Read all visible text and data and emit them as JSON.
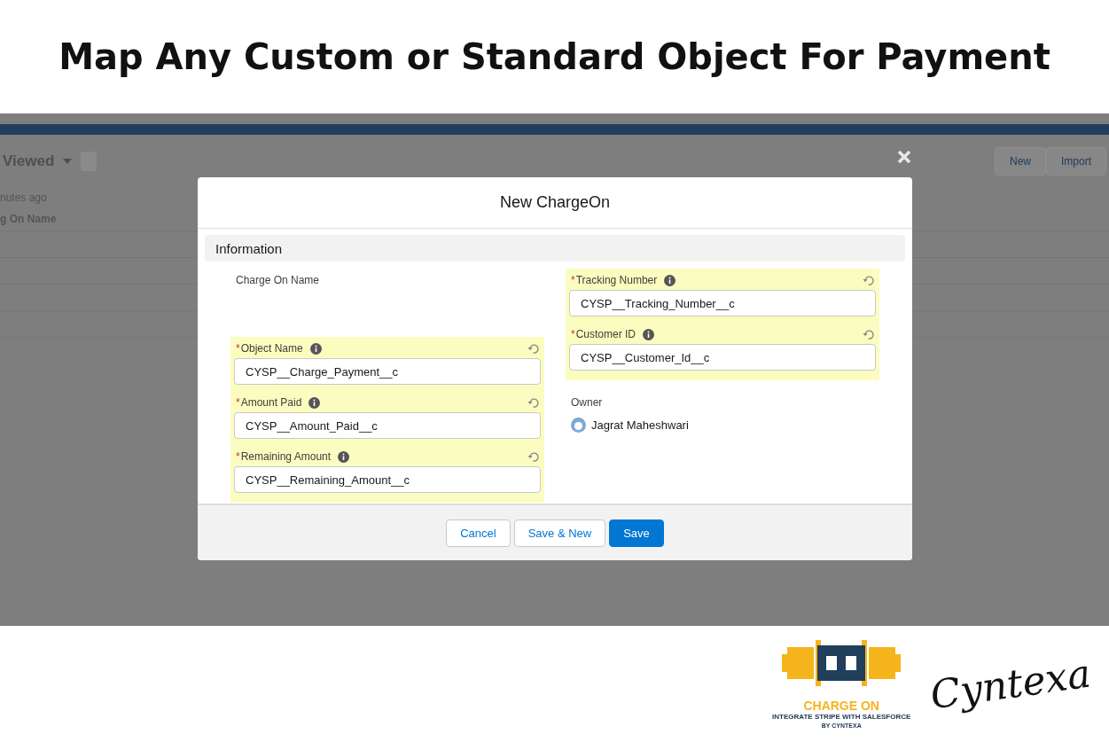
{
  "heading": "Map Any Custom or Standard Object For Payment",
  "background_app": {
    "list_title": "Viewed",
    "subtitle": "nutes ago",
    "column_header": "g On Name",
    "buttons": [
      "New",
      "Import"
    ]
  },
  "modal": {
    "title": "New ChargeOn",
    "section": "Information",
    "columns": [
      [
        {
          "highlighted": false,
          "fields": [
            {
              "kind": "blank",
              "label": "Charge On Name"
            }
          ]
        },
        {
          "highlighted": true,
          "fields": [
            {
              "kind": "input",
              "required_mark": "*",
              "label": "Object Name",
              "value": "CYSP__Charge_Payment__c"
            },
            {
              "kind": "input",
              "required_mark": "*",
              "label": "Amount Paid",
              "value": "CYSP__Amount_Paid__c"
            },
            {
              "kind": "input",
              "required_mark": "*",
              "label": "Remaining Amount",
              "value": "CYSP__Remaining_Amount__c"
            }
          ]
        }
      ],
      [
        {
          "highlighted": true,
          "fields": [
            {
              "kind": "input",
              "required_mark": "*",
              "label": "Tracking Number",
              "value": "CYSP__Tracking_Number__c"
            },
            {
              "kind": "input",
              "required_mark": "*",
              "label": "Customer ID",
              "value": "CYSP__Customer_Id__c"
            }
          ]
        },
        {
          "highlighted": false,
          "fields": [
            {
              "kind": "owner",
              "label": "Owner",
              "value": "Jagrat Maheshwari"
            }
          ]
        }
      ]
    ],
    "buttons": [
      {
        "label": "Cancel",
        "kind": "neutral"
      },
      {
        "label": "Save & New",
        "kind": "neutral"
      },
      {
        "label": "Save",
        "kind": "brand"
      }
    ]
  },
  "branding": {
    "product": "CHARGE ON",
    "tagline": "INTEGRATE STRIPE WITH SALESFORCE",
    "byline": "BY CYNTEXA",
    "company": "Cyntexa"
  }
}
